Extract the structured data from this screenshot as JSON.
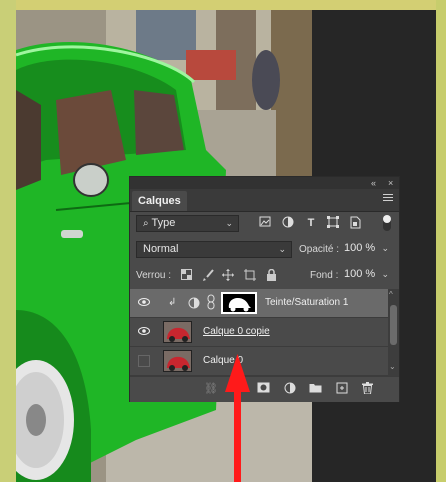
{
  "panel": {
    "collapse_glyph": "«",
    "close_glyph": "×",
    "tab_label": "Calques",
    "menu_icon": "panel-menu-icon"
  },
  "filter": {
    "type_label": "Type",
    "icons": [
      "image-filter-icon",
      "adjustment-filter-icon",
      "text-filter-icon",
      "shape-filter-icon",
      "smart-object-filter-icon"
    ]
  },
  "blend": {
    "mode": "Normal",
    "opacity_label": "Opacité :",
    "opacity_value": "100 %"
  },
  "lock": {
    "label": "Verrou :",
    "fill_label": "Fond :",
    "fill_value": "100 %"
  },
  "layers": [
    {
      "name": "Teinte/Saturation 1",
      "selected": true
    },
    {
      "name": "Calque 0 copie",
      "selected": false
    },
    {
      "name": "Calque 0",
      "selected": false
    }
  ],
  "colors": {
    "annotation_arrow": "#ff1a1a",
    "car_green": "#1fb626"
  }
}
